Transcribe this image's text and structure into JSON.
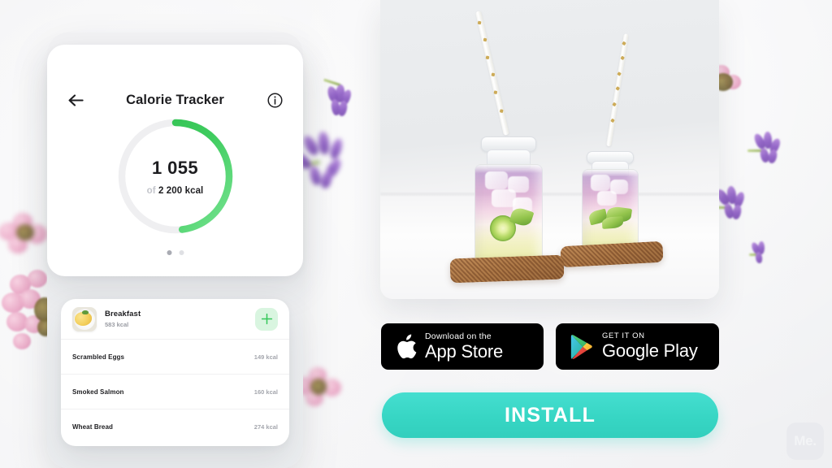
{
  "app": {
    "header": {
      "title": "Calorie Tracker",
      "back_icon": "arrow-left-icon",
      "info_icon": "info-circle-icon"
    },
    "calorie_ring": {
      "value": "1 055",
      "of_label": "of",
      "goal": "2 200 kcal",
      "consumed_kcal": 1055,
      "goal_kcal": 2200,
      "percent": 48,
      "track_color": "#efeff1",
      "progress_color_start": "#2fbf4f",
      "progress_color_end": "#6fe08a"
    },
    "pager": {
      "total": 2,
      "active_index": 0
    },
    "meal": {
      "name": "Breakfast",
      "kcal": "583 kcal",
      "thumbnail_icon": "scrambled-eggs-plate-icon",
      "add_icon": "plus-icon",
      "add_button_bg": "#d9f5e0"
    },
    "foods": [
      {
        "name": "Scrambled Eggs",
        "kcal": "149 kcal"
      },
      {
        "name": "Smoked Salmon",
        "kcal": "160 kcal"
      },
      {
        "name": "Wheat Bread",
        "kcal": "274 kcal"
      }
    ]
  },
  "photo": {
    "alt": "two glass bottles of pink and yellow lemonade with lime slices and gold star paper straws on rattan coasters"
  },
  "store_badges": {
    "apple": {
      "small": "Download on the",
      "big": "App Store",
      "icon": "apple-logo-icon"
    },
    "google": {
      "small": "GET IT ON",
      "big": "Google Play",
      "icon": "google-play-triangle-icon"
    }
  },
  "cta": {
    "install_label": "INSTALL",
    "color": "#37d6c4"
  },
  "watermark": {
    "label": "Me."
  }
}
